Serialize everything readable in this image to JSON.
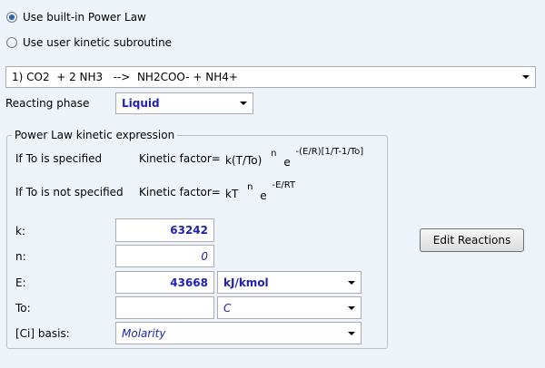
{
  "options": {
    "builtin_label": "Use built-in Power Law",
    "user_label": "Use user kinetic subroutine"
  },
  "reaction": {
    "selected": "1) CO2  + 2 NH3   -->  NH2COO- + NH4+"
  },
  "phase": {
    "label": "Reacting phase",
    "value": "Liquid"
  },
  "group": {
    "title": "Power Law kinetic expression",
    "to_specified": "If To is specified",
    "to_not_specified": "If To is not specified",
    "kf_label": "Kinetic factor=",
    "kf1_base": "k(T/To)",
    "kf1_n": "n",
    "kf1_e": "e",
    "kf1_exp": "-(E/R)[1/T-1/To]",
    "kf2_base": "kT",
    "kf2_n": "n",
    "kf2_e": "e",
    "kf2_exp": "-E/RT"
  },
  "fields": {
    "k_label": "k:",
    "k_value": "63242",
    "n_label": "n:",
    "n_value": "0",
    "E_label": "E:",
    "E_value": "43668",
    "E_unit": "kJ/kmol",
    "To_label": "To:",
    "To_value": "",
    "To_unit": "C",
    "basis_label": "[Ci] basis:",
    "basis_value": "Molarity"
  },
  "buttons": {
    "edit_reactions": "Edit Reactions"
  }
}
